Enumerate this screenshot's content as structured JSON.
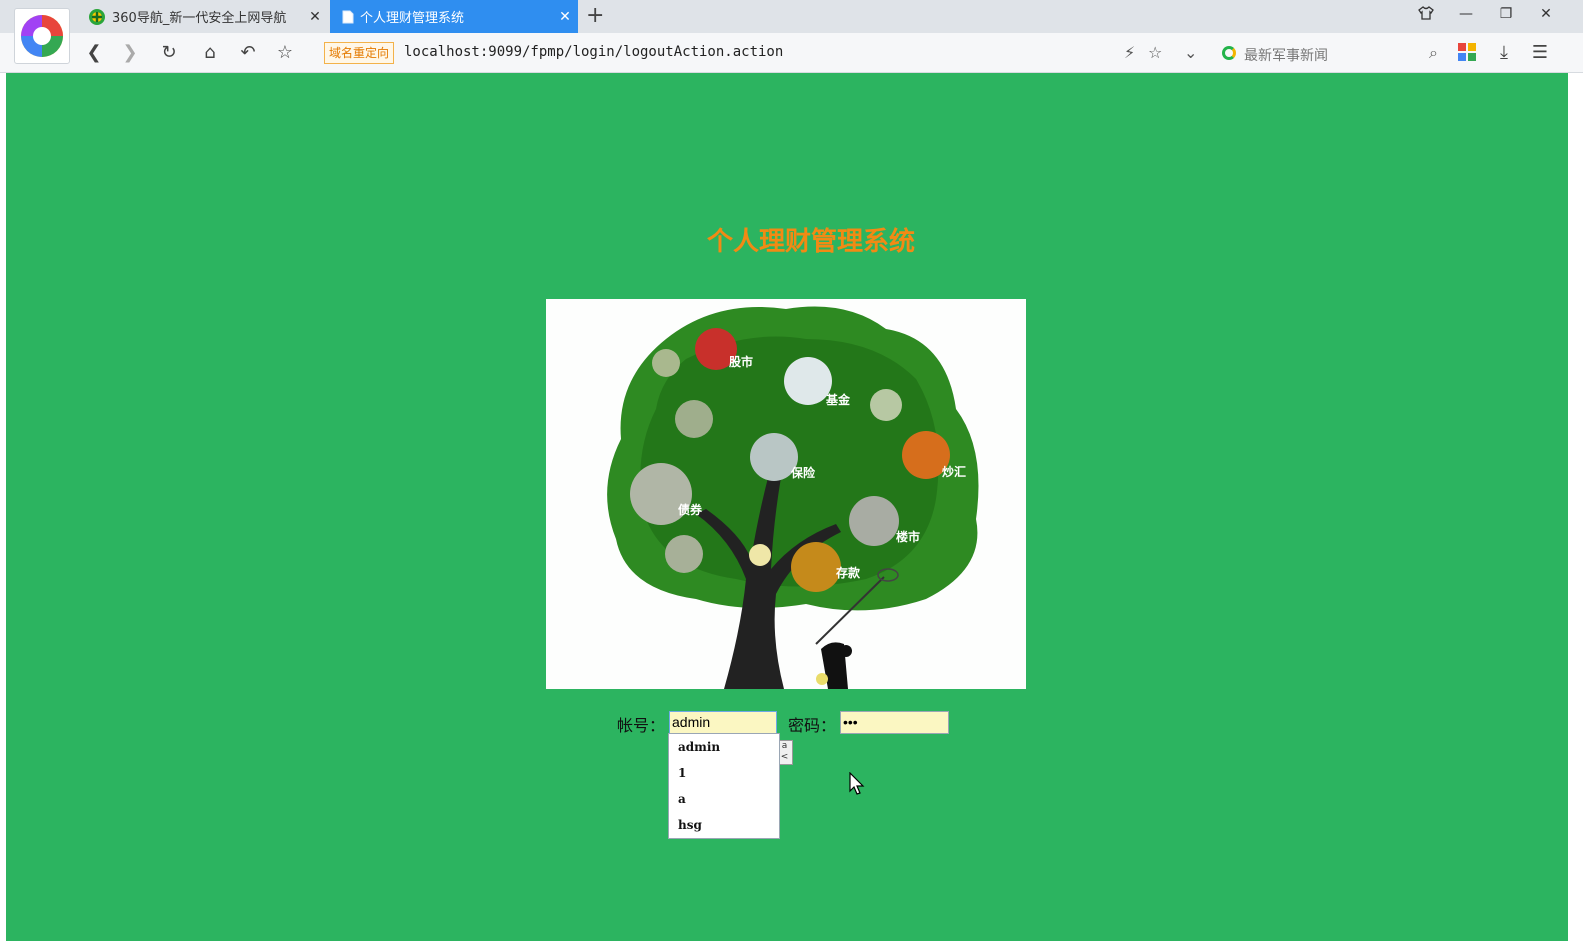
{
  "browser": {
    "tabs": [
      {
        "title": "360导航_新一代安全上网导航",
        "active": false
      },
      {
        "title": "个人理财管理系统",
        "active": true
      }
    ],
    "redirect_badge": "域名重定向",
    "url": "localhost:9099/fpmp/login/logoutAction.action",
    "search_placeholder": "最新军事新闻",
    "accent_color": "#2f8ef0"
  },
  "page": {
    "title": "个人理财管理系统",
    "background_color": "#2cb460",
    "title_color": "#f28a14",
    "tree_labels": {
      "stock": "股市",
      "fund": "基金",
      "insurance": "保险",
      "forex": "炒汇",
      "bond": "债券",
      "realestate": "楼市",
      "deposit": "存款"
    },
    "login": {
      "username_label": "帐号：",
      "username_value": "admin",
      "password_label": "密码：",
      "password_value": "•••",
      "autocomplete": [
        "admin",
        "1",
        "a",
        "hsg"
      ]
    }
  }
}
